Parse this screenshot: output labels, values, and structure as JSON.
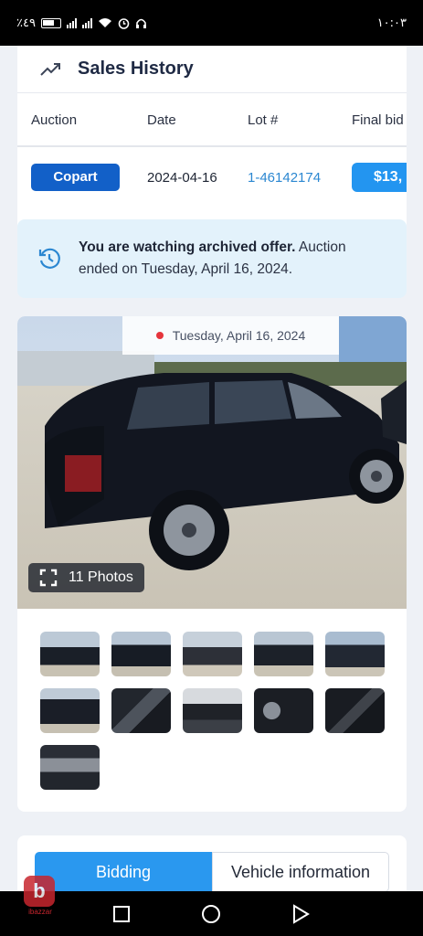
{
  "status_bar": {
    "battery": "٪٤٩",
    "time": "١٠:٠٣"
  },
  "sales_history": {
    "title": "Sales History",
    "columns": [
      "Auction",
      "Date",
      "Lot #",
      "Final bid"
    ],
    "rows": [
      {
        "auction": "Copart",
        "date": "2024-04-16",
        "lot": "1-46142174",
        "final_bid": "$13,"
      }
    ]
  },
  "archived_notice": {
    "bold": "You are watching archived offer.",
    "text": " Auction ended on Tuesday, April 16, 2024."
  },
  "gallery": {
    "date": "Tuesday, April 16, 2024",
    "photos_label": "11 Photos",
    "thumb_count": 11
  },
  "tabs": [
    {
      "label": "Bidding",
      "active": true
    },
    {
      "label": "Vehicle information",
      "active": false
    }
  ],
  "watermark": {
    "text": "ibazzar",
    "letter": "b"
  },
  "colors": {
    "primary": "#1260c8",
    "accent": "#2395f0",
    "link": "#2b87d1",
    "notice_bg": "#e3f2fb"
  }
}
